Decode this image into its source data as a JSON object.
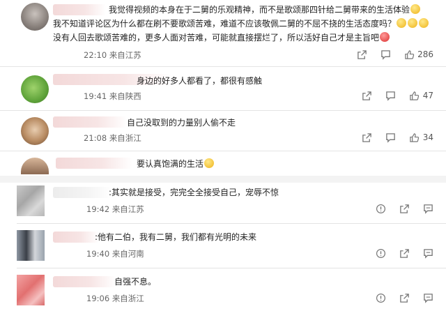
{
  "comments": [
    {
      "text": "我觉得视频的本身在于二舅的乐观精神，而不是歌颂那四针给二舅带来的生活体验",
      "text2": "我不知道评论区为什么都在刷不要歌颂苦难，难道不应该敬佩二舅的不屈不挠的生活态度吗？",
      "text3": "没有人回去歌颂苦难的，更多人面对苦难，可能就直接摆烂了，所以活好自己才是主旨吧",
      "time": "22:10",
      "location": "来自江苏",
      "likes": "286"
    },
    {
      "text": "身边的好多人都看了，都很有感触",
      "time": "19:41",
      "location": "来自陕西",
      "likes": "47"
    },
    {
      "text": "自己没取到的力量别人偷不走",
      "time": "21:08",
      "location": "来自浙江",
      "likes": "34"
    },
    {
      "text": "要认真饱满的生活"
    },
    {
      "text": ":其实就是接受，完完全全接受自己，宠辱不惊",
      "time": "19:42",
      "location": "来自江苏"
    },
    {
      "text": ":他有二伯，我有二舅，我们都有光明的未来",
      "time": "19:40",
      "location": "来自河南"
    },
    {
      "text": "自强不息。",
      "time": "19:06",
      "location": "来自浙江"
    }
  ],
  "icons": {
    "share": "share-icon",
    "comment": "comment-icon",
    "like": "thumbs-up-icon",
    "report": "report-icon",
    "more": "more-icon"
  }
}
